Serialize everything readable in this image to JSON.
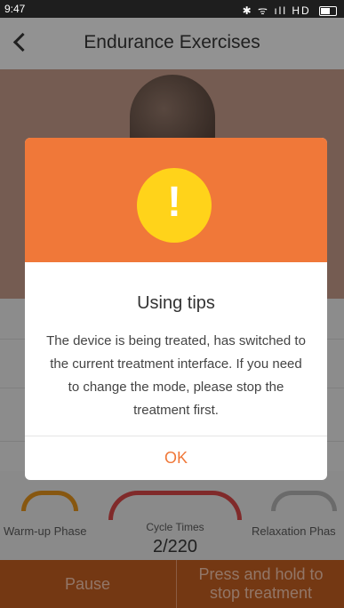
{
  "status_bar": {
    "time": "9:47",
    "icons_text": "✱ ᯤ ıll HD"
  },
  "header": {
    "title": "Endurance Exercises"
  },
  "phases": {
    "warmup": "Warm-up Phase",
    "cycle_title": "Cycle Times",
    "cycle_value": "2/220",
    "relaxation": "Relaxation Phas"
  },
  "bottom": {
    "pause": "Pause",
    "stop_line1": "Press and hold to",
    "stop_line2": "stop treatment"
  },
  "dialog": {
    "title": "Using tips",
    "body": "The device is being treated, has switched to the current treatment interface. If you need to change the mode, please stop the treatment first.",
    "ok": "OK",
    "icon_mark": "!"
  },
  "colors": {
    "accent": "#f07839",
    "warning_yellow": "#ffd31a",
    "bottom_bar": "#b6581e"
  },
  "icons": {
    "back": "back-chevron-icon",
    "warning": "exclamation-icon",
    "bluetooth": "bluetooth-icon",
    "wifi": "wifi-icon",
    "signal": "signal-icon",
    "battery": "battery-icon"
  }
}
